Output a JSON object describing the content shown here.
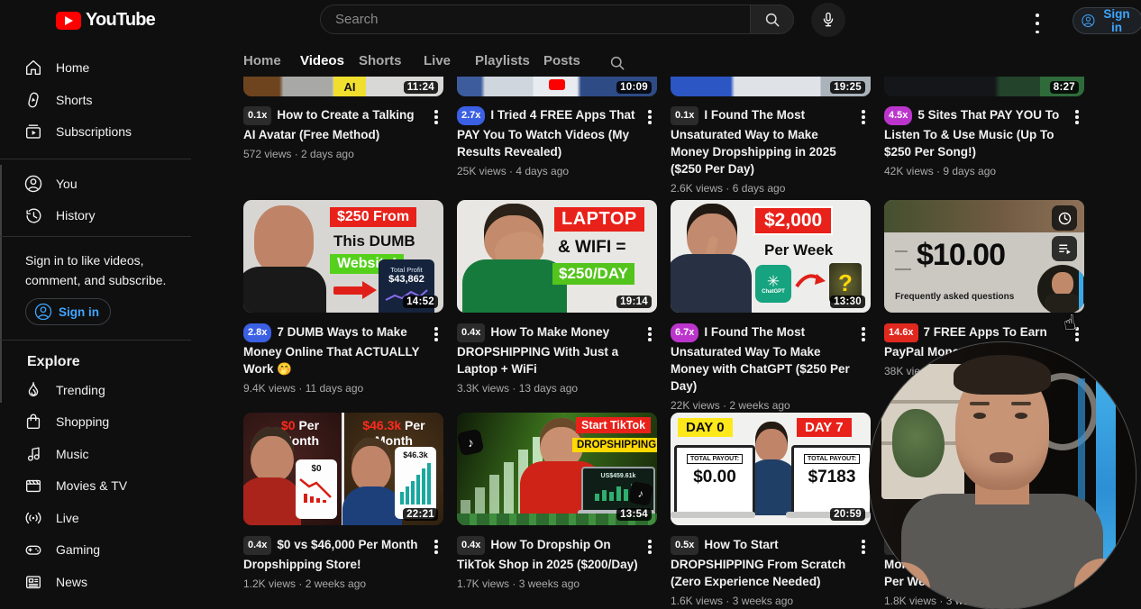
{
  "topbar": {
    "logo": "YouTube",
    "search_placeholder": "Search",
    "signin": "Sign in"
  },
  "sidebar": {
    "items_main": [
      {
        "label": "Home"
      },
      {
        "label": "Shorts"
      },
      {
        "label": "Subscriptions"
      }
    ],
    "items_you": [
      {
        "label": "You"
      },
      {
        "label": "History"
      }
    ],
    "promo_line1": "Sign in to like videos,",
    "promo_line2": "comment, and subscribe.",
    "signin": "Sign in",
    "explore": "Explore",
    "items_explore": [
      {
        "label": "Trending"
      },
      {
        "label": "Shopping"
      },
      {
        "label": "Music"
      },
      {
        "label": "Movies & TV"
      },
      {
        "label": "Live"
      },
      {
        "label": "Gaming"
      },
      {
        "label": "News"
      }
    ]
  },
  "tabs": {
    "items": [
      "Home",
      "Videos",
      "Shorts",
      "Live",
      "Playlists",
      "Posts"
    ],
    "active": "Videos"
  },
  "colors": {
    "badge_gray": "#2b2b2b",
    "badge_blue": "#3b60e4",
    "badge_purple": "#bb35cc",
    "badge_red": "#e0281e",
    "accent_blue": "#3ea6ff"
  },
  "videos": [
    {
      "badge": "0.1x",
      "title": "How to Create a Talking AI Avatar (Free Method)",
      "meta": "572 views · 2 days ago",
      "duration": "11:24",
      "thumb": {
        "ai": "AI"
      }
    },
    {
      "badge": "2.7x",
      "title": "I Tried 4 FREE Apps That PAY You To Watch Videos (My Results Revealed)",
      "meta": "25K views · 4 days ago",
      "duration": "10:09"
    },
    {
      "badge": "0.1x",
      "title": "I Found The Most Unsaturated Way to Make Money Dropshipping in 2025 ($250 Per Day)",
      "meta": "2.6K views · 6 days ago",
      "duration": "19:25"
    },
    {
      "badge": "4.5x",
      "title": "5 Sites That PAY YOU To Listen To & Use Music (Up To $250 Per Song!)",
      "meta": "42K views · 9 days ago",
      "duration": "8:27"
    },
    {
      "badge": "2.8x",
      "title": "7 DUMB Ways to Make Money Online That ACTUALLY Work 🤭",
      "meta": "9.4K views · 11 days ago",
      "duration": "14:52",
      "thumb": {
        "l1": "$250 From",
        "l2": "This DUMB",
        "l3": "Website!",
        "p1": "Total Profit",
        "p2": "$43,862"
      }
    },
    {
      "badge": "0.4x",
      "title": "How To Make Money DROPSHIPPING With Just a Laptop + WiFi",
      "meta": "3.3K views · 13 days ago",
      "duration": "19:14",
      "thumb": {
        "l1": "LAPTOP",
        "l2": "& WIFI =",
        "l3": "$250/DAY"
      }
    },
    {
      "badge": "6.7x",
      "title": "I Found The Most Unsaturated Way To Make Money with ChatGPT ($250 Per Day)",
      "meta": "22K views · 2 weeks ago",
      "duration": "13:30",
      "thumb": {
        "l1": "$2,000",
        "l2": "Per Week",
        "logo": "ChatGPT",
        "q": "?"
      }
    },
    {
      "badge": "14.6x",
      "title": "7 FREE Apps To Earn PayPal Money (Person",
      "meta": "38K vie",
      "thumb": {
        "price": "$10.00",
        "faq": "Frequently asked questions"
      }
    },
    {
      "badge": "0.4x",
      "title": "$0 vs $46,000 Per Month Dropshipping Store!",
      "meta": "1.2K views · 2 weeks ago",
      "duration": "22:21",
      "thumb": {
        "left1": "$0",
        "left1b": " Per",
        "left2": "Month",
        "right1": "$46.3k",
        "right1b": " Per",
        "right2": "Month",
        "pl": "$0",
        "pr": "$46.3k"
      }
    },
    {
      "badge": "0.4x",
      "title": "How To Dropship On TikTok Shop in 2025 ($200/Day)",
      "meta": "1.7K views · 3 weeks ago",
      "duration": "13:54",
      "thumb": {
        "l1": "Start TikTok",
        "l2": "DROPSHIPPING",
        "laptop": "US$459.61k"
      }
    },
    {
      "badge": "0.5x",
      "title": "How To Start DROPSHIPPING From Scratch (Zero Experience Needed)",
      "meta": "1.6K views · 3 weeks ago",
      "duration": "20:59",
      "thumb": {
        "d0": "DAY 0",
        "d7": "DAY 7",
        "tp": "TOTAL PAYOUT:",
        "v0": "$0.00",
        "v7": "$7183"
      }
    },
    {
      "badge": "0.4x",
      "title_line2": "Money (",
      "title_line3": "Per Week)",
      "meta": "1.8K views · 3 weeks ago"
    }
  ]
}
